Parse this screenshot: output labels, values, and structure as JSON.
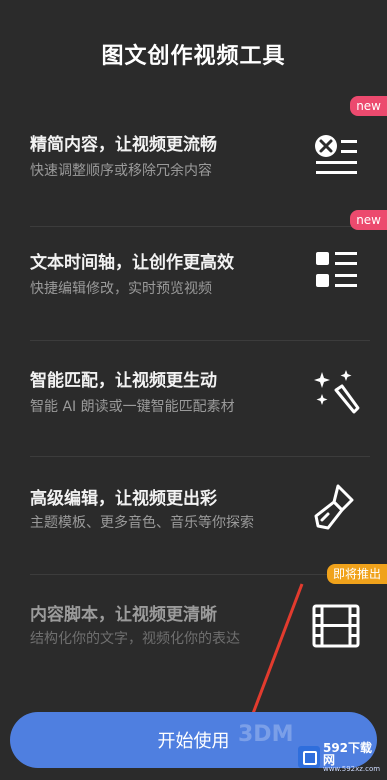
{
  "header": {
    "title": "图文创作视频工具"
  },
  "features": [
    {
      "title": "精简内容，让视频更流畅",
      "desc": "快速调整顺序或移除冗余内容",
      "badge": "new",
      "icon": "remove-list-icon"
    },
    {
      "title": "文本时间轴，让创作更高效",
      "desc": "快捷编辑修改，实时预览视频",
      "badge": "new",
      "icon": "timeline-list-icon"
    },
    {
      "title": "智能匹配，让视频更生动",
      "desc": "智能 AI 朗读或一键智能匹配素材",
      "badge": "",
      "icon": "magic-wand-icon"
    },
    {
      "title": "高级编辑，让视频更出彩",
      "desc": "主题模板、更多音色、音乐等你探索",
      "badge": "",
      "icon": "brush-icon"
    },
    {
      "title": "内容脚本，让视频更清晰",
      "desc": "结构化你的文字，视频化你的表达",
      "badge": "即将推出",
      "icon": "film-strip-icon"
    }
  ],
  "start_button": {
    "label": "开始使用"
  },
  "watermark": {
    "main": "592下载网",
    "sub": "www.592xz.com"
  },
  "overlay": "3DM",
  "colors": {
    "background": "#2b2b2b",
    "accent": "#4f7fe0",
    "new_badge": "#ec4a6e",
    "soon_badge": "#f0a21b"
  }
}
